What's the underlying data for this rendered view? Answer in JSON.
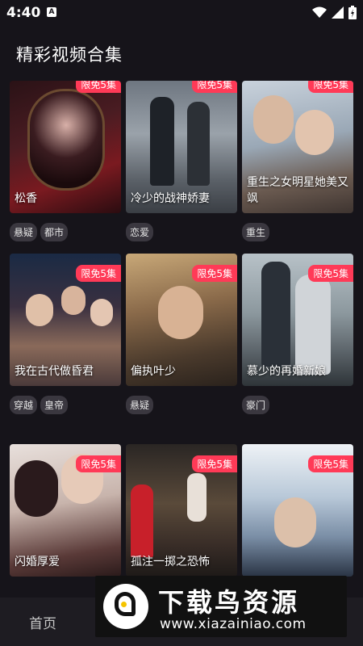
{
  "status": {
    "time": "4:40",
    "app_icon_letter": "A"
  },
  "page": {
    "title": "精彩视频合集"
  },
  "colors": {
    "background": "#16141a",
    "badge": "#ff3a57",
    "tag": "#3a373f"
  },
  "cards": [
    {
      "title": "松香",
      "badge": "限免5集",
      "tags": [
        "悬疑",
        "都市"
      ]
    },
    {
      "title": "冷少的战神娇妻",
      "badge": "限免5集",
      "tags": [
        "恋爱"
      ]
    },
    {
      "title": "重生之女明星她美又飒",
      "badge": "限免5集",
      "tags": [
        "重生"
      ]
    },
    {
      "title": "我在古代做昏君",
      "badge": "限免5集",
      "tags": [
        "穿越",
        "皇帝"
      ]
    },
    {
      "title": "偏执叶少",
      "badge": "限免5集",
      "tags": [
        "悬疑"
      ]
    },
    {
      "title": "慕少的再婚新娘",
      "badge": "限免5集",
      "tags": [
        "豪门"
      ]
    },
    {
      "title": "闪婚厚爱",
      "badge": "限免5集",
      "tags": []
    },
    {
      "title": "孤注一掷之恐怖",
      "badge": "限免5集",
      "tags": []
    },
    {
      "title": "",
      "badge": "限免5集",
      "tags": []
    }
  ],
  "nav": {
    "home": "首页"
  },
  "watermark": {
    "brand": "下载鸟资源",
    "url": "www.xiazainiao.com"
  }
}
